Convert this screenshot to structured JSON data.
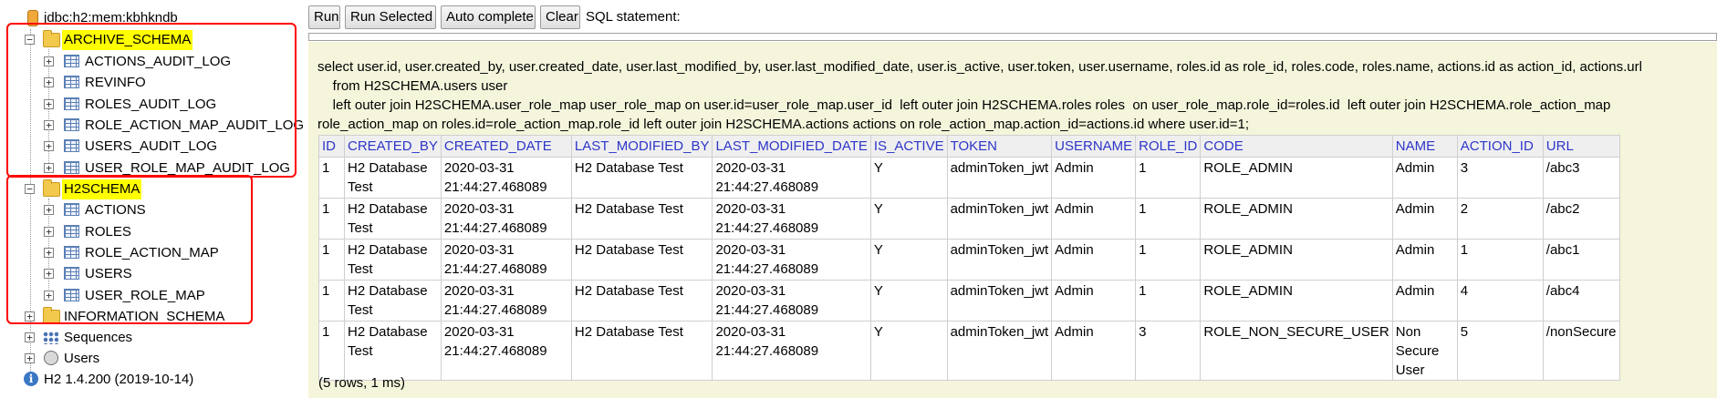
{
  "tree": {
    "connection": "jdbc:h2:mem:kbhkndb",
    "schemas": [
      {
        "name": "ARCHIVE_SCHEMA",
        "expander": "−",
        "tables": [
          "ACTIONS_AUDIT_LOG",
          "REVINFO",
          "ROLES_AUDIT_LOG",
          "ROLE_ACTION_MAP_AUDIT_LOG",
          "USERS_AUDIT_LOG",
          "USER_ROLE_MAP_AUDIT_LOG"
        ]
      },
      {
        "name": "H2SCHEMA",
        "expander": "−",
        "tables": [
          "ACTIONS",
          "ROLES",
          "ROLE_ACTION_MAP",
          "USERS",
          "USER_ROLE_MAP"
        ]
      }
    ],
    "info_schema": "INFORMATION_SCHEMA",
    "sequences": "Sequences",
    "users": "Users",
    "version": "H2 1.4.200 (2019-10-14)",
    "expander_plus": "+",
    "highlight_color": "#ffff00",
    "annotation_color": "#ff0000"
  },
  "toolbar": {
    "run": "Run",
    "run_selected": "Run Selected",
    "auto_complete": "Auto complete",
    "clear": "Clear",
    "sql_label": "SQL statement:"
  },
  "results": {
    "sql_lines": [
      "select user.id, user.created_by, user.created_date, user.last_modified_by, user.last_modified_date, user.is_active, user.token, user.username, roles.id as role_id, roles.code, roles.name, actions.id as action_id, actions.url",
      "    from H2SCHEMA.users user",
      "    left outer join H2SCHEMA.user_role_map user_role_map on user.id=user_role_map.user_id  left outer join H2SCHEMA.roles roles  on user_role_map.role_id=roles.id  left outer join H2SCHEMA.role_action_map",
      "role_action_map on roles.id=role_action_map.role_id  left outer join H2SCHEMA.actions actions on role_action_map.action_id=actions.id where user.id=1;"
    ],
    "columns": [
      "ID",
      "CREATED_BY",
      "CREATED_DATE",
      "LAST_MODIFIED_BY",
      "LAST_MODIFIED_DATE",
      "IS_ACTIVE",
      "TOKEN",
      "USERNAME",
      "ROLE_ID",
      "CODE",
      "NAME",
      "ACTION_ID",
      "URL"
    ],
    "rows": [
      [
        "1",
        "H2 Database Test",
        "2020-03-31 21:44:27.468089",
        "H2 Database Test",
        "2020-03-31 21:44:27.468089",
        "Y",
        "adminToken_jwt",
        "Admin",
        "1",
        "ROLE_ADMIN",
        "Admin",
        "3",
        "/abc3"
      ],
      [
        "1",
        "H2 Database Test",
        "2020-03-31 21:44:27.468089",
        "H2 Database Test",
        "2020-03-31 21:44:27.468089",
        "Y",
        "adminToken_jwt",
        "Admin",
        "1",
        "ROLE_ADMIN",
        "Admin",
        "2",
        "/abc2"
      ],
      [
        "1",
        "H2 Database Test",
        "2020-03-31 21:44:27.468089",
        "H2 Database Test",
        "2020-03-31 21:44:27.468089",
        "Y",
        "adminToken_jwt",
        "Admin",
        "1",
        "ROLE_ADMIN",
        "Admin",
        "1",
        "/abc1"
      ],
      [
        "1",
        "H2 Database Test",
        "2020-03-31 21:44:27.468089",
        "H2 Database Test",
        "2020-03-31 21:44:27.468089",
        "Y",
        "adminToken_jwt",
        "Admin",
        "1",
        "ROLE_ADMIN",
        "Admin",
        "4",
        "/abc4"
      ],
      [
        "1",
        "H2 Database Test",
        "2020-03-31 21:44:27.468089",
        "H2 Database Test",
        "2020-03-31 21:44:27.468089",
        "Y",
        "adminToken_jwt",
        "Admin",
        "3",
        "ROLE_NON_SECURE_USER",
        "Non Secure User",
        "5",
        "/nonSecure"
      ]
    ],
    "row_count": "(5 rows, 1 ms)",
    "header_color": "#2e35c9",
    "background": "#f5f5dc"
  }
}
